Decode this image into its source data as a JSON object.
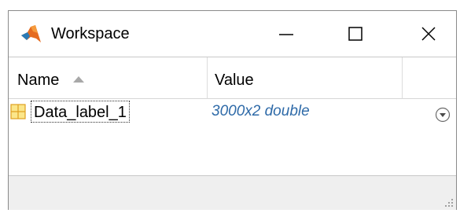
{
  "window": {
    "title": "Workspace",
    "controls": {
      "minimize": "minimize-icon",
      "maximize": "maximize-icon",
      "close": "close-icon"
    }
  },
  "table": {
    "columns": [
      "Name",
      "Value"
    ],
    "sort": {
      "column": "Name",
      "direction": "ascending"
    },
    "rows": [
      {
        "name": "Data_label_1",
        "value": "3000x2 double",
        "icon": "matrix-grid-icon"
      }
    ]
  },
  "colors": {
    "value_text": "#2e6aa8",
    "icon_matrix_fill": "#fbe68a",
    "icon_matrix_border": "#e0a020",
    "statusbar": "#efefef"
  }
}
